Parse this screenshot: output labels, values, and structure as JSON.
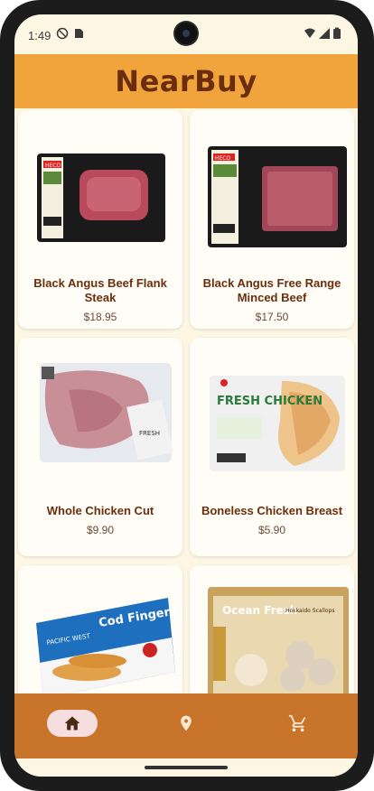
{
  "status_bar": {
    "time": "1:49"
  },
  "app": {
    "title": "NearBuy"
  },
  "products": [
    {
      "name": "Black Angus Beef Flank Steak",
      "price": "$18.95",
      "package_label": "HECO"
    },
    {
      "name": "Black Angus Free Range Minced Beef",
      "price": "$17.50",
      "package_label": "HECO"
    },
    {
      "name": "Whole Chicken Cut",
      "price": "$9.90",
      "package_label": "FRESH"
    },
    {
      "name": "Boneless Chicken Breast",
      "price": "$5.90",
      "package_label": "FRESH CHICKEN"
    },
    {
      "name": "Cod Fingers",
      "price": "",
      "package_label": "Cod Fingers",
      "brand": "PACIFIC WEST"
    },
    {
      "name": "Hokkaido Scallops",
      "price": "",
      "package_label": "Ocean Fresh",
      "brand": "Hokkaido Scallops"
    }
  ],
  "nav": {
    "items": [
      {
        "name": "home",
        "icon": "home-icon",
        "active": true
      },
      {
        "name": "location",
        "icon": "location-pin-icon",
        "active": false
      },
      {
        "name": "cart",
        "icon": "cart-icon",
        "active": false
      }
    ]
  },
  "colors": {
    "app_bar": "#f1a43c",
    "title": "#6a2e0e",
    "bottom_nav": "#c8742b",
    "background": "#fdf6e3"
  }
}
